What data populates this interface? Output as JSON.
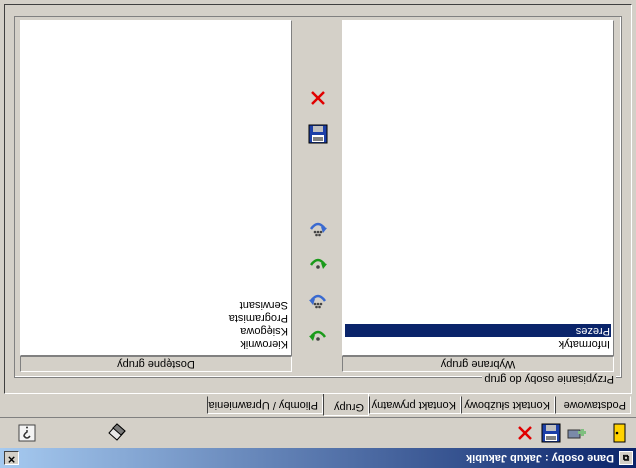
{
  "window": {
    "title": "Dane osoby : Jakub Jakubik",
    "close_glyph": "✕"
  },
  "toolbar": {
    "buttons": [
      {
        "name": "exit-icon"
      },
      {
        "name": "add-person-icon"
      },
      {
        "name": "save-icon"
      },
      {
        "name": "delete-icon"
      },
      {
        "name": "eraser-icon"
      },
      {
        "name": "help-icon"
      }
    ]
  },
  "tabs": [
    {
      "label": "Podstawowe"
    },
    {
      "label": "Kontakt służbowy"
    },
    {
      "label": "Kontakt prywatny"
    },
    {
      "label": "Grupy",
      "active": true
    },
    {
      "label": "Pliomby / Uprawnienia"
    }
  ],
  "groupbox": {
    "label": "Przypisanie osoby do grup"
  },
  "available": {
    "header": "Dostępne grupy",
    "items": [
      "Kierownik",
      "Księgowa",
      "Programista",
      "Serwisant"
    ]
  },
  "selected": {
    "header": "Wybrane grupy",
    "items": [
      {
        "label": "Informatyk",
        "selected": false
      },
      {
        "label": "Prezes",
        "selected": true
      }
    ]
  },
  "middle_buttons": [
    {
      "name": "add-one-icon"
    },
    {
      "name": "add-all-icon"
    },
    {
      "name": "remove-one-icon"
    },
    {
      "name": "remove-all-icon"
    },
    {
      "name": "save-icon"
    },
    {
      "name": "cancel-icon"
    }
  ],
  "colors": {
    "title_bar": "#0a246a",
    "selection": "#0a246a",
    "face": "#d4d0c8"
  }
}
